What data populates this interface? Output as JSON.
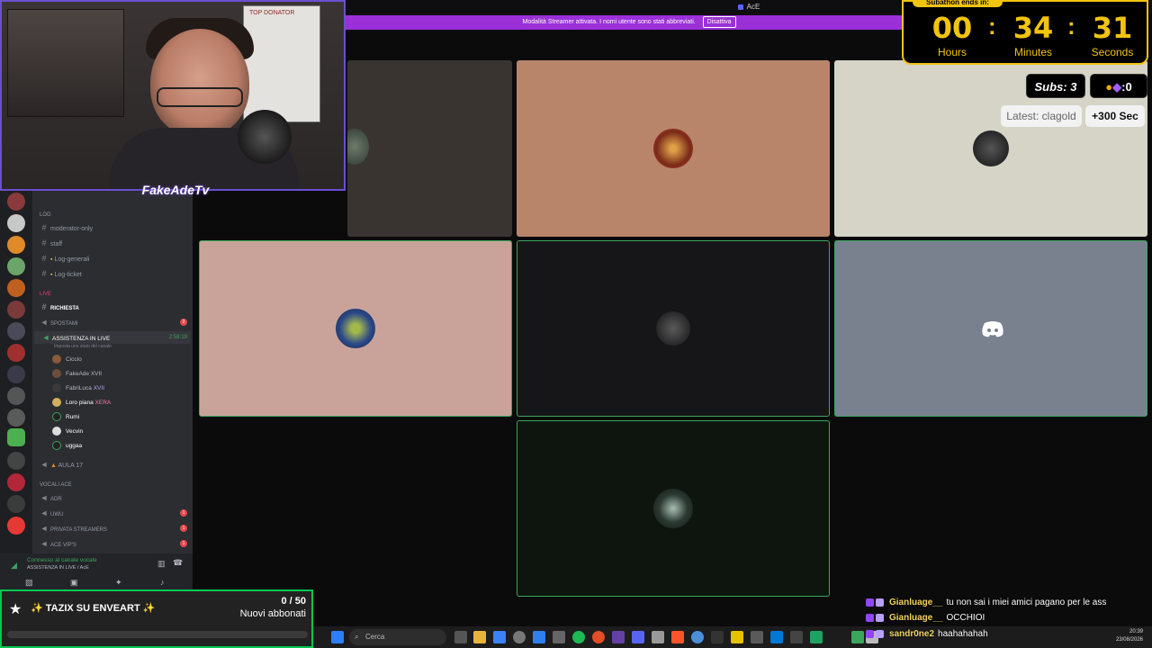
{
  "window": {
    "title": "AcE"
  },
  "streamer_banner": {
    "text": "Modalità Streamer attivata. I nomi utente sono stati abbreviati.",
    "button": "Disattiva"
  },
  "webcam": {
    "name": "FakeAdeTv",
    "board_text": "TOP DONATOR"
  },
  "sidebar": {
    "categories": [
      {
        "label": "LOG"
      },
      {
        "label": "LIVE"
      },
      {
        "label": "Vocali AcE"
      }
    ],
    "log_channels": [
      "moderator-only",
      "staff",
      "Log-generali",
      "Log-ticket"
    ],
    "live_channels": [
      "RICHIESTA",
      "SPOSTAMI"
    ],
    "active_voice": {
      "name": "ASSISTENZA IN LIVE",
      "time": "2:58:19",
      "status": "Imposta uno stato del canale"
    },
    "voice_users": [
      {
        "name": "Ciccio"
      },
      {
        "name": "FakeAde XVII"
      },
      {
        "name": "FabriLuca",
        "tag": "XVII"
      },
      {
        "name": "Loro piana",
        "tag": "XERA"
      },
      {
        "name": "Rumi"
      },
      {
        "name": "Vecvin"
      },
      {
        "name": "uggaa"
      }
    ],
    "aula": "AULA 17",
    "vocali_channels": [
      "ADR",
      "UWU",
      "PRIVATA STREAMERS",
      "ACE VIP'S"
    ],
    "voice_panel": {
      "status": "Connesso al canale vocale",
      "channel": "ASSISTENZA IN LIVE / AcE"
    }
  },
  "timer": {
    "header": "Subathon ends in:",
    "hours": "00",
    "minutes": "34",
    "seconds": "31",
    "hours_label": "Hours",
    "minutes_label": "Minutes",
    "seconds_label": "Seconds"
  },
  "subs": {
    "label": "Subs: 3",
    "coins": "0"
  },
  "latest": {
    "label": "Latest: clagold",
    "bonus": "+300 Sec"
  },
  "sub_goal": {
    "title": "✨ TAZIX SU ENVEART ✨",
    "count": "0 / 50",
    "label": "Nuovi abbonati",
    "progress": 0.0
  },
  "chat": [
    {
      "user": "Gianluage__",
      "text": "tu non sai i miei amici pagano per le ass"
    },
    {
      "user": "Gianluage__",
      "text": "OCCHIOI"
    },
    {
      "user": "sandr0ne2",
      "text": "haahahahah"
    }
  ],
  "taskbar": {
    "search": "Cerca",
    "time": "20:39",
    "date": "23/08/2026"
  },
  "tile_colors": [
    "#3a3430",
    "#b8856a",
    "#d6d4c6",
    "#c9a39a",
    "#161618",
    "#79808e",
    "#0e150f"
  ]
}
